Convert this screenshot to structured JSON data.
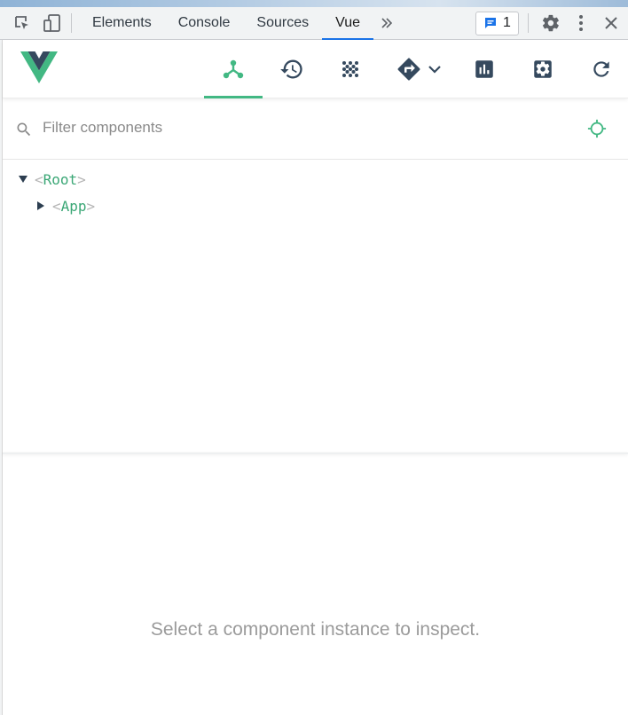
{
  "devtools": {
    "tabs": [
      {
        "label": "Elements",
        "active": false
      },
      {
        "label": "Console",
        "active": false
      },
      {
        "label": "Sources",
        "active": false
      },
      {
        "label": "Vue",
        "active": true
      }
    ],
    "more_tabs_icon": "chevron-double-right-icon",
    "issues_count": "1",
    "accent_color": "#1a73e8"
  },
  "vue_toolbar": {
    "logo": "vue-logo",
    "buttons": [
      {
        "icon": "component-tree-icon",
        "active": true
      },
      {
        "icon": "history-icon",
        "active": false
      },
      {
        "icon": "vuex-dots-icon",
        "active": false
      },
      {
        "icon": "routing-icon",
        "active": false
      },
      {
        "icon": "performance-chart-icon",
        "active": false
      },
      {
        "icon": "settings-icon",
        "active": false
      },
      {
        "icon": "refresh-icon",
        "active": false
      }
    ],
    "accent_color": "#42b883"
  },
  "filter": {
    "placeholder": "Filter components",
    "value": ""
  },
  "component_tree": {
    "nodes": [
      {
        "name": "Root",
        "expanded": true,
        "depth": 0
      },
      {
        "name": "App",
        "expanded": false,
        "depth": 1
      }
    ],
    "open_bracket": "<",
    "close_bracket": ">"
  },
  "inspector": {
    "empty_message": "Select a component instance to inspect."
  }
}
